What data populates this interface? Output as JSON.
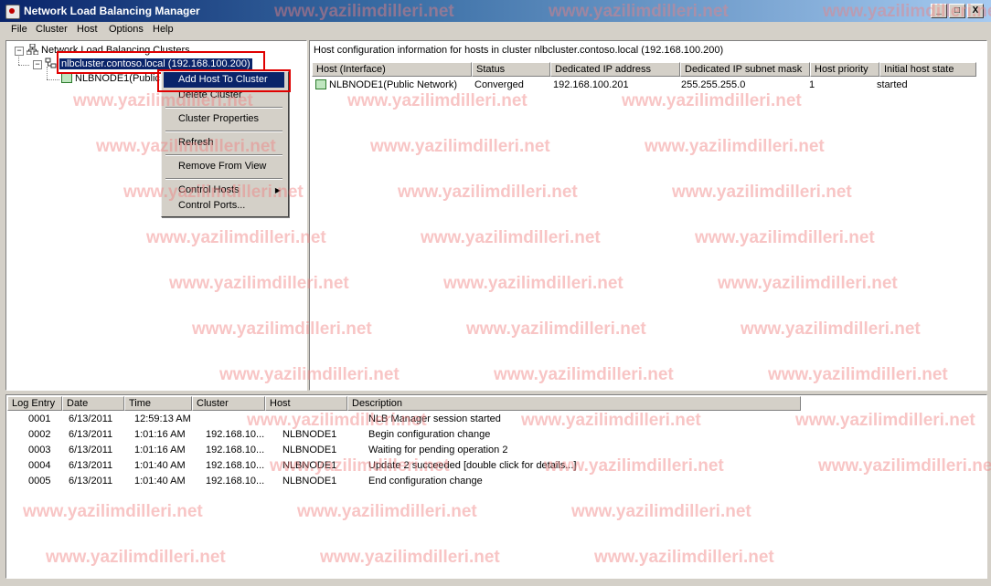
{
  "window": {
    "title": "Network Load Balancing Manager",
    "buttons": [
      "_",
      "□",
      "X"
    ]
  },
  "menubar": [
    "File",
    "Cluster",
    "Host",
    "Options",
    "Help"
  ],
  "tree": {
    "root": "Network Load Balancing Clusters",
    "cluster": "nlbcluster.contoso.local (192.168.100.200)",
    "node": "NLBNODE1(Public"
  },
  "context_menu": {
    "items": [
      {
        "label": "Add Host To Cluster",
        "highlighted": true
      },
      {
        "label": "Delete Cluster"
      },
      {
        "label": "Cluster Properties"
      },
      {
        "label": "Refresh"
      },
      {
        "label": "Remove From View"
      },
      {
        "label": "Control Hosts",
        "submenu": true
      },
      {
        "label": "Control Ports..."
      }
    ]
  },
  "host_pane": {
    "header": "Host configuration information for hosts in cluster nlbcluster.contoso.local (192.168.100.200)",
    "columns": [
      "Host (Interface)",
      "Status",
      "Dedicated IP address",
      "Dedicated IP subnet mask",
      "Host priority",
      "Initial host state"
    ],
    "rows": [
      [
        "NLBNODE1(Public Network)",
        "Converged",
        "192.168.100.201",
        "255.255.255.0",
        "1",
        "started"
      ]
    ]
  },
  "log_pane": {
    "columns": [
      "Log Entry",
      "Date",
      "Time",
      "Cluster",
      "Host",
      "Description"
    ],
    "rows": [
      [
        "0001",
        "6/13/2011",
        "12:59:13 AM",
        "",
        "",
        "NLB Manager session started"
      ],
      [
        "0002",
        "6/13/2011",
        "1:01:16 AM",
        "192.168.10...",
        "NLBNODE1",
        "Begin configuration change"
      ],
      [
        "0003",
        "6/13/2011",
        "1:01:16 AM",
        "192.168.10...",
        "NLBNODE1",
        "Waiting for pending operation 2"
      ],
      [
        "0004",
        "6/13/2011",
        "1:01:40 AM",
        "192.168.10...",
        "NLBNODE1",
        "Update 2 succeeded [double click for details...]"
      ],
      [
        "0005",
        "6/13/2011",
        "1:01:40 AM",
        "192.168.10...",
        "NLBNODE1",
        "End configuration change"
      ]
    ]
  },
  "watermark": "www.yazilimdilleri.net",
  "colors": {
    "title_start": "#0a246a",
    "title_end": "#a6caf0",
    "highlight": "#0a246a",
    "annotation": "#e00000",
    "watermark": "#f08080"
  }
}
